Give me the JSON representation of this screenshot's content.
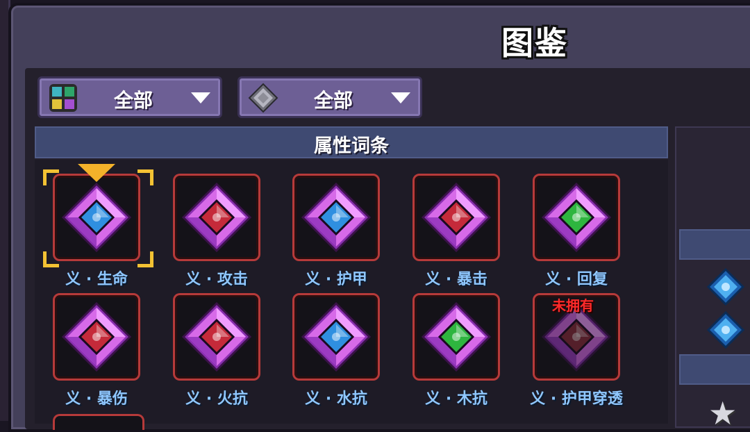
{
  "title": "图鉴",
  "filters": [
    {
      "label": "全部",
      "icon": "category-grid-icon"
    },
    {
      "label": "全部",
      "icon": "gray-gem-icon"
    }
  ],
  "section_title": "属性词条",
  "not_owned_text": "未拥有",
  "items": [
    {
      "label": "义 · 生命",
      "color": "#2f8fe0",
      "selected": true,
      "owned": true
    },
    {
      "label": "义 · 攻击",
      "color": "#c52a3a",
      "selected": false,
      "owned": true
    },
    {
      "label": "义 · 护甲",
      "color": "#2f8fe0",
      "selected": false,
      "owned": true
    },
    {
      "label": "义 · 暴击",
      "color": "#c52a3a",
      "selected": false,
      "owned": true
    },
    {
      "label": "义 · 回复",
      "color": "#2eb53f",
      "selected": false,
      "owned": true
    },
    {
      "label": "义 · 暴伤",
      "color": "#c52a3a",
      "selected": false,
      "owned": true
    },
    {
      "label": "义 · 火抗",
      "color": "#c52a3a",
      "selected": false,
      "owned": true
    },
    {
      "label": "义 · 水抗",
      "color": "#2f8fe0",
      "selected": false,
      "owned": true
    },
    {
      "label": "义 · 木抗",
      "color": "#2eb53f",
      "selected": false,
      "owned": true
    },
    {
      "label": "义 · 护甲穿透",
      "color": "#8a2a3a",
      "selected": false,
      "owned": false
    }
  ],
  "colors": {
    "frame_purple": "#b84fd6",
    "card_border": "#b63a3a",
    "label_blue": "#8fc7ff",
    "selection_gold": "#f3c233"
  }
}
